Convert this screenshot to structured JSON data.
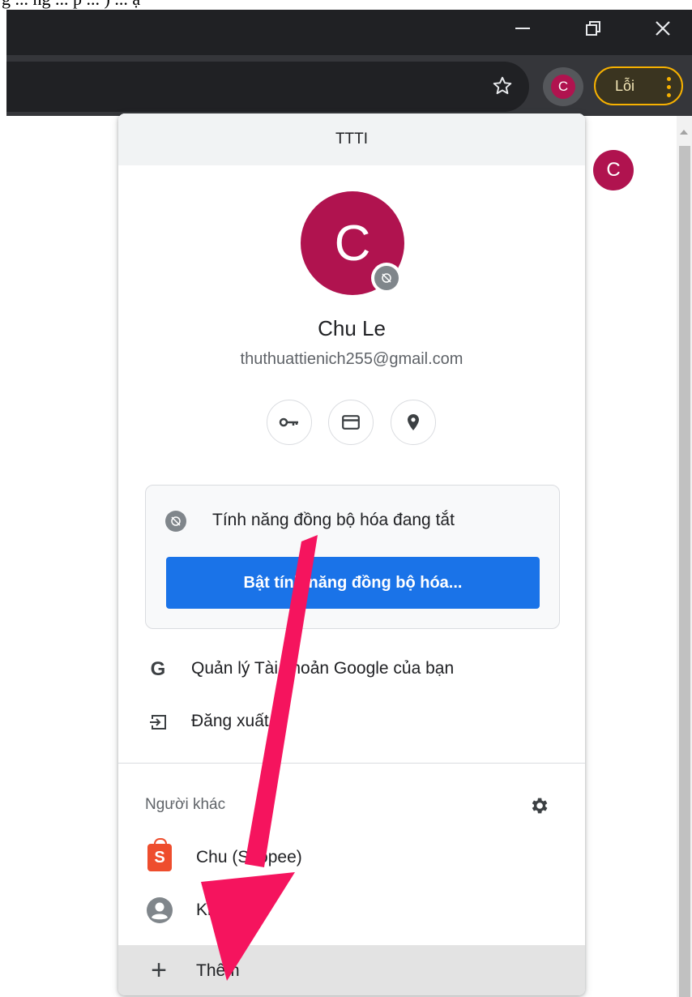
{
  "top_caption": "g ... ng ... p ... )  ... ạ",
  "window": {
    "minimize_icon": "minimize-icon",
    "maximize_icon": "restore-icon",
    "close_icon": "close-icon"
  },
  "toolbar": {
    "avatar_letter": "C",
    "error_label": "Lỗi"
  },
  "content": {
    "avatar_letter": "C"
  },
  "profile_panel": {
    "header_title": "TTTI",
    "avatar_letter": "C",
    "name": "Chu Le",
    "email": "thuthuattienich255@gmail.com",
    "quick_actions": [
      "key-icon",
      "credit-card-icon",
      "location-pin-icon"
    ],
    "sync": {
      "status": "Tính năng đồng bộ hóa đang tắt",
      "button_label": "Bật tính năng đồng bộ hóa..."
    },
    "menu": {
      "manage_account": "Quản lý Tài khoản Google của bạn",
      "sign_out": "Đăng xuất"
    },
    "others": {
      "label": "Người khác",
      "profiles": [
        {
          "name": "Chu (Shopee)",
          "icon": "shopee-icon"
        },
        {
          "name": "Khách",
          "icon": "person-icon"
        }
      ],
      "add_label": "Thêm"
    }
  },
  "colors": {
    "avatar": "#b0134f",
    "sync_button": "#1a73e8",
    "error_pill": "#f7b100",
    "annotation_arrow": "#f5145e"
  }
}
